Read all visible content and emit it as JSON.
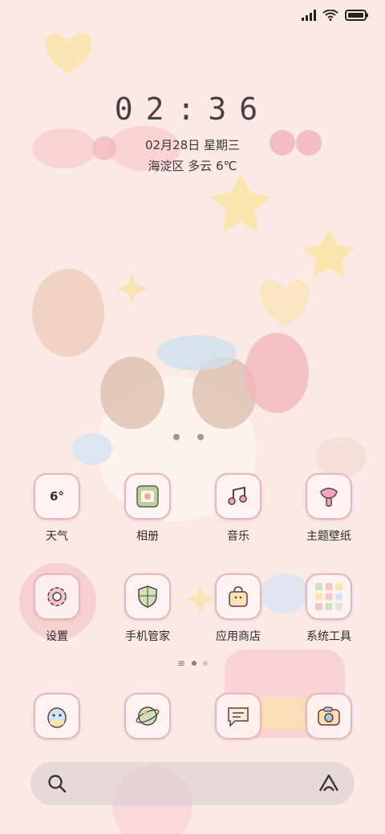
{
  "lockscreen": {
    "time": "02:36",
    "date": "02月28日 星期三",
    "weather_line": "海淀区 多云 6℃"
  },
  "apps": [
    {
      "label": "天气",
      "icon": "weather-widget-icon",
      "value": "6°"
    },
    {
      "label": "相册",
      "icon": "gallery-icon"
    },
    {
      "label": "音乐",
      "icon": "music-icon"
    },
    {
      "label": "主题壁纸",
      "icon": "theme-icon"
    },
    {
      "label": "设置",
      "icon": "gear-icon"
    },
    {
      "label": "手机管家",
      "icon": "shield-icon"
    },
    {
      "label": "应用商店",
      "icon": "store-bag-icon"
    },
    {
      "label": "系统工具",
      "icon": "folder-icon"
    }
  ],
  "dock": [
    {
      "icon": "phone-character-icon"
    },
    {
      "icon": "browser-planet-icon"
    },
    {
      "icon": "message-icon"
    },
    {
      "icon": "camera-icon"
    }
  ],
  "colors": {
    "background": "#fbe9e6",
    "tile_border": "#e4b6bd",
    "text": "#2f2a2a"
  }
}
